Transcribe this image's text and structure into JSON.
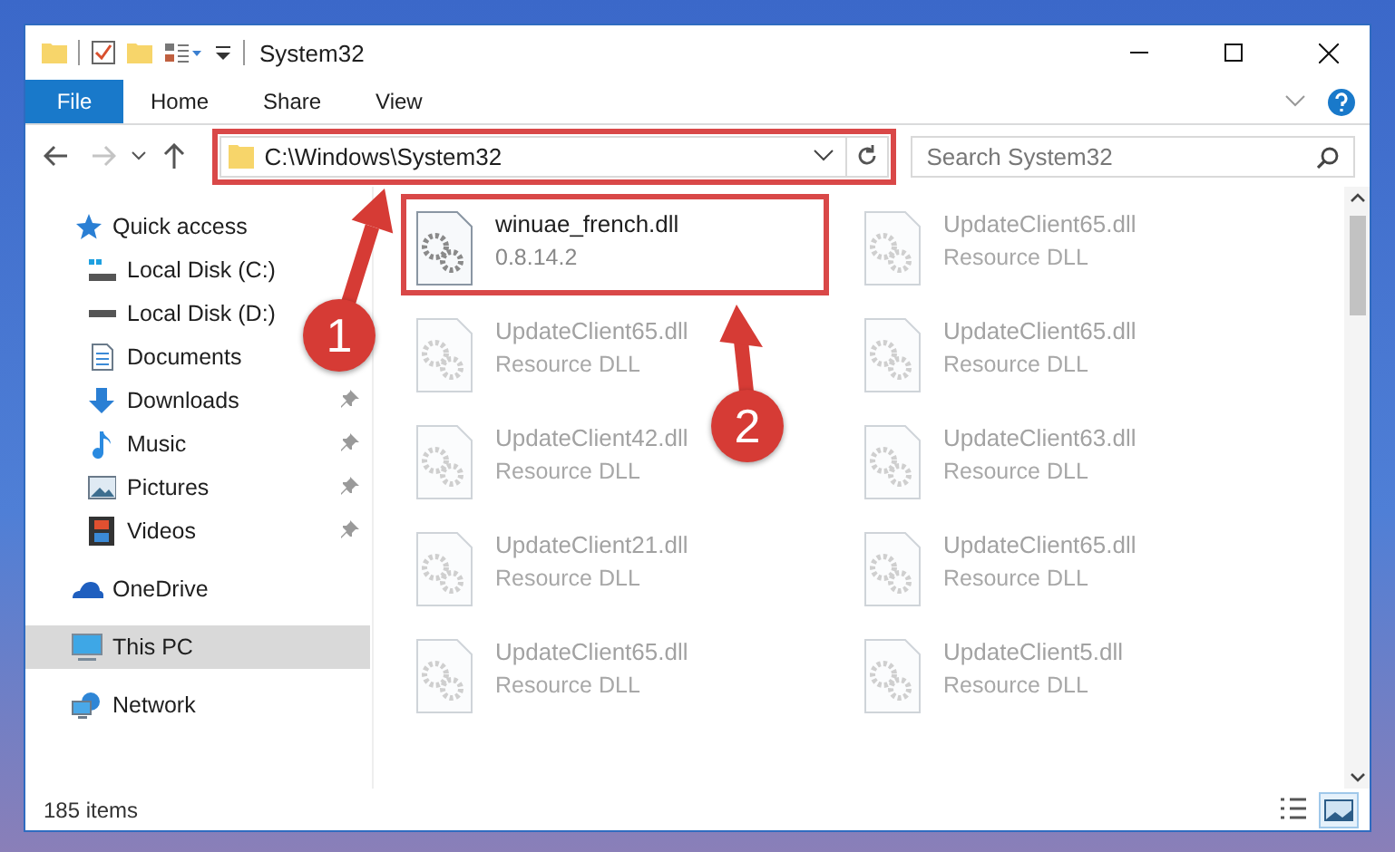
{
  "window": {
    "title": "System32"
  },
  "ribbon_tabs": [
    {
      "label": "File",
      "kind": "file"
    },
    {
      "label": "Home",
      "kind": "tab"
    },
    {
      "label": "Share",
      "kind": "tab"
    },
    {
      "label": "View",
      "kind": "tab"
    }
  ],
  "navigation": {
    "back": {
      "disabled": false
    },
    "forward": {
      "disabled": true
    }
  },
  "address_bar": {
    "path": "C:\\Windows\\System32",
    "highlighted": true
  },
  "search": {
    "placeholder": "Search System32"
  },
  "sidebar": {
    "items": [
      {
        "label": "Quick access",
        "selected": false,
        "children": [
          {
            "label": "Local Disk (C:)",
            "pinned": false,
            "selected": false
          },
          {
            "label": "Local Disk (D:)",
            "pinned": false,
            "selected": false
          },
          {
            "label": "Documents",
            "pinned": false,
            "selected": false
          },
          {
            "label": "Downloads",
            "pinned": true,
            "selected": false
          },
          {
            "label": "Music",
            "pinned": true,
            "selected": false
          },
          {
            "label": "Pictures",
            "pinned": true,
            "selected": false
          },
          {
            "label": "Videos",
            "pinned": true,
            "selected": false
          }
        ]
      },
      {
        "label": "OneDrive",
        "selected": false
      },
      {
        "label": "This PC",
        "selected": true
      },
      {
        "label": "Network",
        "selected": false
      }
    ]
  },
  "files": [
    {
      "name": "winuae_french.dll",
      "detail": "0.8.14.2",
      "dimmed": false,
      "highlighted": true
    },
    {
      "name": "UpdateClient65.dll",
      "detail": "Resource DLL",
      "dimmed": true,
      "highlighted": false
    },
    {
      "name": "UpdateClient65.dll",
      "detail": "Resource DLL",
      "dimmed": true,
      "highlighted": false
    },
    {
      "name": "UpdateClient65.dll",
      "detail": "Resource DLL",
      "dimmed": true,
      "highlighted": false
    },
    {
      "name": "UpdateClient42.dll",
      "detail": "Resource DLL",
      "dimmed": true,
      "highlighted": false
    },
    {
      "name": "UpdateClient63.dll",
      "detail": "Resource DLL",
      "dimmed": true,
      "highlighted": false
    },
    {
      "name": "UpdateClient21.dll",
      "detail": "Resource DLL",
      "dimmed": true,
      "highlighted": false
    },
    {
      "name": "UpdateClient65.dll",
      "detail": "Resource DLL",
      "dimmed": true,
      "highlighted": false
    },
    {
      "name": "UpdateClient65.dll",
      "detail": "Resource DLL",
      "dimmed": true,
      "highlighted": false
    },
    {
      "name": "UpdateClient5.dll",
      "detail": "Resource DLL",
      "dimmed": true,
      "highlighted": false
    }
  ],
  "annotations": [
    {
      "label": "1"
    },
    {
      "label": "2"
    }
  ],
  "status_bar": {
    "item_count": "185 items"
  }
}
